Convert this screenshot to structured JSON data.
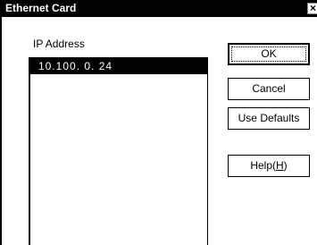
{
  "window": {
    "title": "Ethernet Card",
    "close_glyph": "×"
  },
  "ip": {
    "label": "IP Address",
    "items": [
      "10.100. 0. 24"
    ]
  },
  "buttons": {
    "ok": "OK",
    "cancel": "Cancel",
    "use_defaults": "Use Defaults",
    "help_prefix": "Help(",
    "help_mnemonic": "H",
    "help_suffix": ")"
  }
}
